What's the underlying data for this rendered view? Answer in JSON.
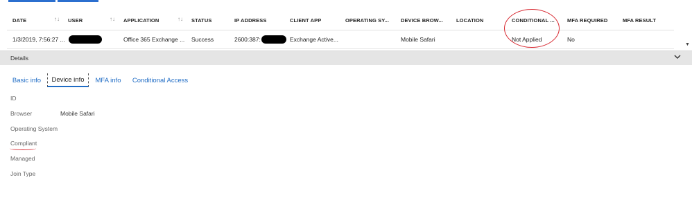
{
  "grid": {
    "columns": [
      {
        "label": "DATE",
        "sortable": true
      },
      {
        "label": "USER",
        "sortable": false
      },
      {
        "label": "APPLICATION",
        "sortable": true
      },
      {
        "label": "STATUS",
        "sortable": false
      },
      {
        "label": "IP ADDRESS",
        "sortable": false
      },
      {
        "label": "CLIENT APP",
        "sortable": false
      },
      {
        "label": "OPERATING SY...",
        "sortable": false
      },
      {
        "label": "DEVICE BROW...",
        "sortable": false
      },
      {
        "label": "LOCATION",
        "sortable": false
      },
      {
        "label": "CONDITIONAL ...",
        "sortable": false
      },
      {
        "label": "MFA REQUIRED",
        "sortable": false
      },
      {
        "label": "MFA RESULT",
        "sortable": false
      }
    ],
    "row": {
      "date": "1/3/2019, 7:56:27 ...",
      "user": "",
      "application": "Office 365 Exchange ...",
      "status": "Success",
      "ip_address": "2600:387:",
      "client_app": "Exchange Active...",
      "operating_system": "",
      "device_browser": "Mobile Safari",
      "location": "",
      "conditional_access": "Not Applied",
      "mfa_required": "No",
      "mfa_result": ""
    }
  },
  "details": {
    "label": "Details",
    "tabs": [
      "Basic info",
      "Device info",
      "MFA info",
      "Conditional Access"
    ],
    "active_tab": "Device info",
    "fields": [
      {
        "label": "ID",
        "value": ""
      },
      {
        "label": "Browser",
        "value": "Mobile Safari"
      },
      {
        "label": "Operating System",
        "value": ""
      },
      {
        "label": "Compliant",
        "value": ""
      },
      {
        "label": "Managed",
        "value": ""
      },
      {
        "label": "Join Type",
        "value": ""
      }
    ]
  },
  "colors": {
    "link": "#1f6cc5",
    "annotation": "#d7262e",
    "details_bar": "#e5e5e5"
  }
}
